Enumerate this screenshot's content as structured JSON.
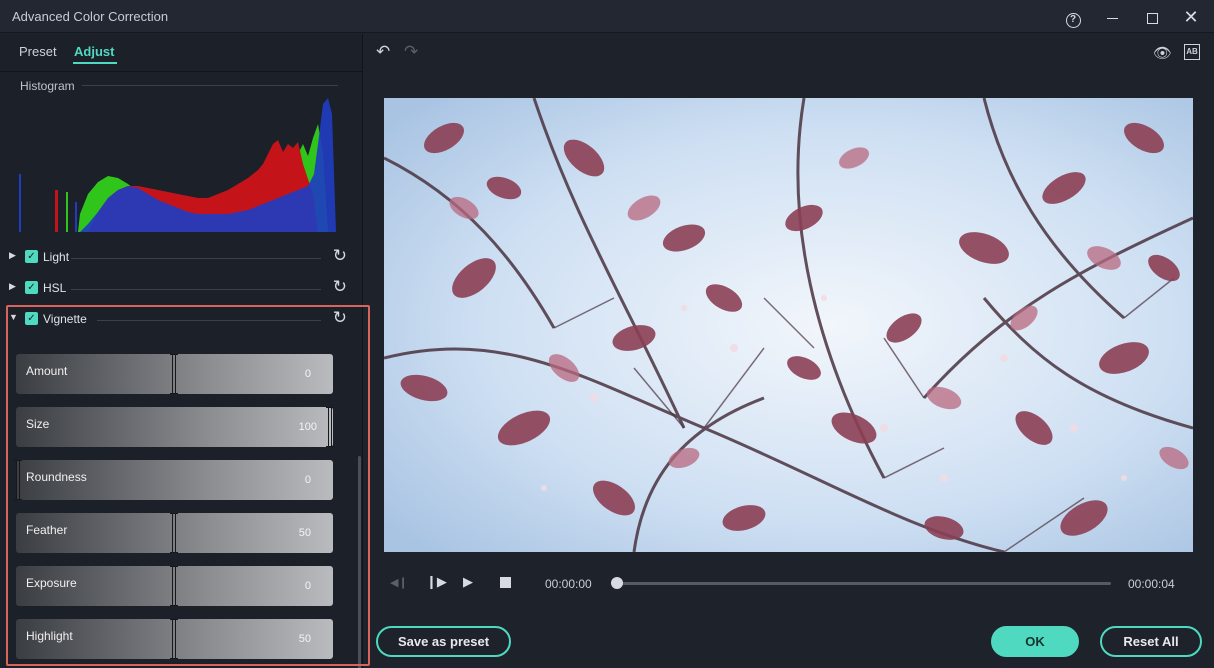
{
  "window": {
    "title": "Advanced Color Correction",
    "help_glyph": "?",
    "close_glyph": "✕"
  },
  "tabs": {
    "preset": "Preset",
    "adjust": "Adjust"
  },
  "histogram": {
    "label": "Histogram"
  },
  "sections": [
    {
      "label": "Light",
      "expanded": false,
      "checked": true
    },
    {
      "label": "HSL",
      "expanded": false,
      "checked": true
    },
    {
      "label": "Vignette",
      "expanded": true,
      "checked": true
    }
  ],
  "vignette": {
    "sliders": [
      {
        "label": "Amount",
        "value": "0"
      },
      {
        "label": "Size",
        "value": "100"
      },
      {
        "label": "Roundness",
        "value": "0"
      },
      {
        "label": "Feather",
        "value": "50"
      },
      {
        "label": "Exposure",
        "value": "0"
      },
      {
        "label": "Highlight",
        "value": "50"
      }
    ]
  },
  "player": {
    "current_time": "00:00:00",
    "end_time": "00:00:04"
  },
  "buttons": {
    "save_preset": "Save as preset",
    "ok": "OK",
    "reset_all": "Reset All"
  },
  "colors": {
    "accent": "#4fd9c1",
    "highlight_border": "#d9645c",
    "background": "#1e222a"
  },
  "icons": {
    "undo": "undo-icon",
    "redo": "redo-icon",
    "preview": "eye-icon",
    "compare": "compare-icon"
  }
}
